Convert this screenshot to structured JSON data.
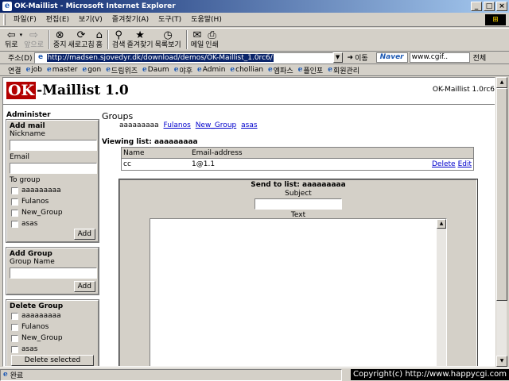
{
  "window": {
    "title": "OK-Maillist - Microsoft Internet Explorer",
    "min": "_",
    "max": "□",
    "close": "×"
  },
  "menu": [
    "파일(F)",
    "편집(E)",
    "보기(V)",
    "즐겨찾기(A)",
    "도구(T)",
    "도움말(H)"
  ],
  "toolbar": {
    "back": "뒤로",
    "forward": "앞으로",
    "stop": "중지",
    "refresh": "새로고침",
    "home": "홈",
    "search": "검색",
    "favorites": "즐겨찾기",
    "history": "목록보기",
    "mail": "메일",
    "print": "인쇄"
  },
  "address": {
    "label": "주소(D)",
    "url": "http://madsen.sjovedyr.dk/download/demos/OK-Maillist_1.0rc6/",
    "go": "이동",
    "naver": "Naver",
    "search_value": "www.cgif..",
    "search_select": "전체"
  },
  "links": {
    "label": "연결",
    "items": [
      "job",
      "master",
      "gon",
      "드림위즈",
      "Daum",
      "야후",
      "Admin",
      "chollian",
      "엠파스",
      "플인포",
      "회원관리"
    ]
  },
  "page": {
    "logo_ok": "OK",
    "logo_rest": "-Maillist 1.0",
    "version": "OK-Maillist 1.0rc6",
    "sidebar": {
      "header": "Administer",
      "add_mail": {
        "title": "Add mail",
        "nickname": "Nickname",
        "email": "Email",
        "to_group": "To group",
        "groups": [
          "aaaaaaaaa",
          "Fulanos",
          "New_Group",
          "asas"
        ],
        "button": "Add"
      },
      "add_group": {
        "title": "Add Group",
        "name_label": "Group Name",
        "button": "Add"
      },
      "delete_group": {
        "title": "Delete Group",
        "groups": [
          "aaaaaaaaa",
          "Fulanos",
          "New_Group",
          "asas"
        ],
        "button": "Delete selected"
      }
    },
    "main": {
      "groups_title": "Groups",
      "groups_current": "aaaaaaaaa",
      "groups_links": [
        "Fulanos",
        "New_Group",
        "asas"
      ],
      "viewing": "Viewing list: aaaaaaaaa",
      "table": {
        "col_name": "Name",
        "col_email": "Email-address",
        "rows": [
          {
            "name": "cc",
            "email": "1@1.1",
            "delete": "Delete",
            "edit": "Edit"
          }
        ]
      },
      "send": {
        "title": "Send to list: aaaaaaaaa",
        "subject": "Subject",
        "text": "Text"
      }
    }
  },
  "status": {
    "text": "완료",
    "copyright": "Copyright(c) http://www.happycgi.com"
  }
}
